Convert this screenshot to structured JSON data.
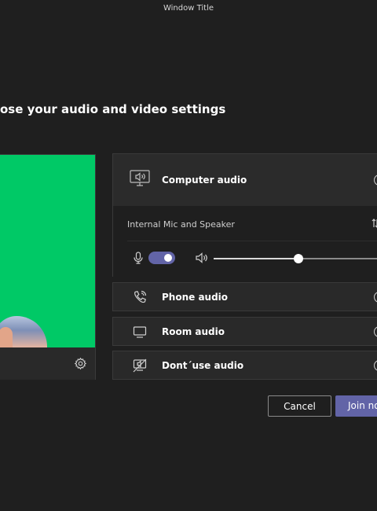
{
  "window": {
    "title": "Window Title"
  },
  "heading": "ose your audio and video settings",
  "video": {
    "settings_icon": "gear-icon"
  },
  "audio": {
    "computer": {
      "label": "Computer audio",
      "icon": "computer-audio-icon",
      "device": "Internal Mic and Speaker",
      "device_switch_icon": "switch-arrows-icon",
      "mic_enabled": true,
      "volume": 0.52
    },
    "options": [
      {
        "label": "Phone audio",
        "icon": "phone-icon"
      },
      {
        "label": "Room audio",
        "icon": "room-display-icon"
      },
      {
        "label": "Dont´use audio",
        "icon": "no-audio-icon"
      }
    ]
  },
  "buttons": {
    "cancel": "Cancel",
    "join": "Join now"
  },
  "colors": {
    "accent": "#6264a7",
    "preview_green": "#00c966",
    "background": "#1f1f1f"
  }
}
